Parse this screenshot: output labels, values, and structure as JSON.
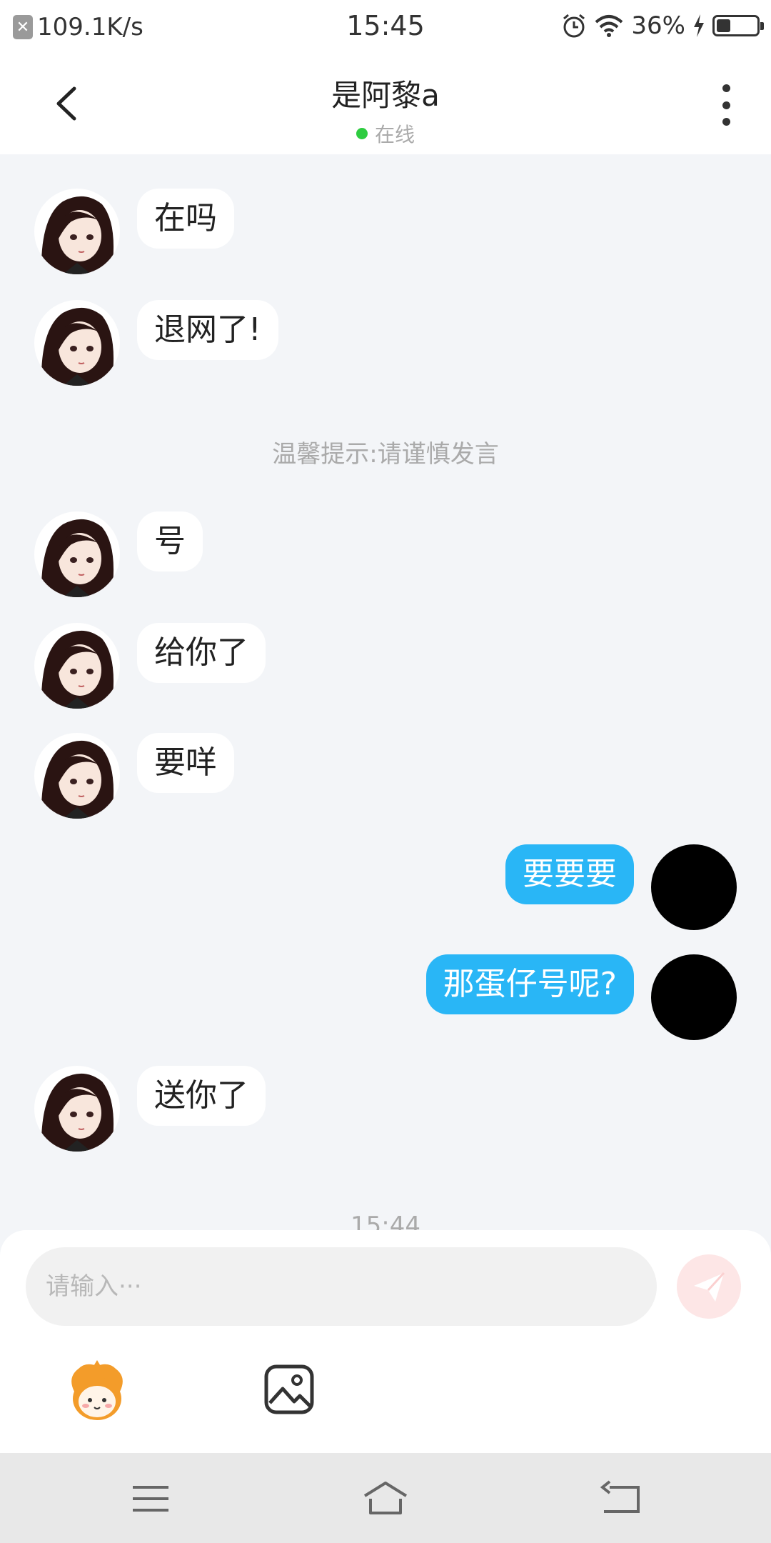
{
  "status_bar": {
    "speed": "109.1K/s",
    "time": "15:45",
    "battery_pct": "36%",
    "battery_level": 0.36
  },
  "header": {
    "title": "是阿黎a",
    "presence": "在线"
  },
  "messages": [
    {
      "side": "left",
      "text": "在吗"
    },
    {
      "side": "left",
      "text": "退网了!"
    },
    {
      "side": "notice",
      "text": "温馨提示:请谨慎发言"
    },
    {
      "side": "left",
      "text": "号"
    },
    {
      "side": "left",
      "text": "给你了"
    },
    {
      "side": "left",
      "text": "要咩"
    },
    {
      "side": "right",
      "text": "要要要"
    },
    {
      "side": "right",
      "text": "那蛋仔号呢?"
    },
    {
      "side": "left",
      "text": "送你了"
    }
  ],
  "timestamp": "15:44",
  "composer": {
    "placeholder": "请输入···"
  },
  "colors": {
    "accent": "#29b6f6",
    "online": "#2ecc40",
    "send_button": "#fde6e6"
  },
  "icons": [
    "back-icon",
    "more-icon",
    "send-icon",
    "emoji-icon",
    "image-icon",
    "menu-icon",
    "home-icon",
    "return-icon"
  ]
}
